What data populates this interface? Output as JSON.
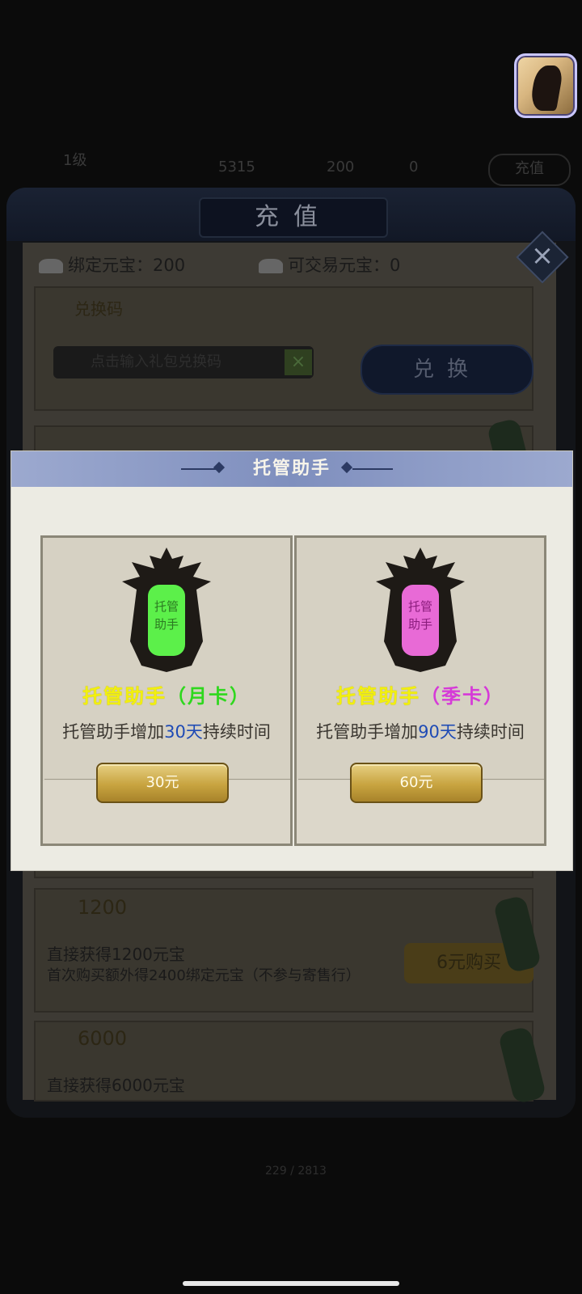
{
  "background": {
    "level": "1级",
    "player_name": "",
    "sub_info": "",
    "stats": [
      "5315",
      "200",
      "0"
    ],
    "recharge_button": "充值",
    "panel_title": "充值",
    "bound_ingot_label": "绑定元宝：200",
    "tradable_ingot_label": "可交易元宝：0",
    "code_section_title": "兑换码",
    "code_input_placeholder": "点击输入礼包兑换码",
    "redeem_button": "兑换",
    "offer_1200_amount": "1200",
    "offer_1200_line1": "直接获得1200元宝",
    "offer_1200_line2": "首次购买额外得2400绑定元宝（不参与寄售行）",
    "offer_1200_price": "6元购买",
    "offer_6000_amount": "6000",
    "offer_6000_line1": "直接获得6000元宝",
    "progress": "229 / 2813"
  },
  "modal": {
    "title": "托管助手",
    "cards": [
      {
        "name": "托管助手",
        "type": "（月卡）",
        "type_color": "#2fd81e",
        "emblem_color": "#5cf04a",
        "emblem_text": "托管助手",
        "desc_prefix": "托管助手增加",
        "desc_highlight": "30天",
        "desc_suffix": "持续时间",
        "price": "30元"
      },
      {
        "name": "托管助手",
        "type": "（季卡）",
        "type_color": "#d63ad8",
        "emblem_color": "#e86ad6",
        "emblem_text": "托管助手",
        "desc_prefix": "托管助手增加",
        "desc_highlight": "90天",
        "desc_suffix": "持续时间",
        "price": "60元"
      }
    ]
  }
}
